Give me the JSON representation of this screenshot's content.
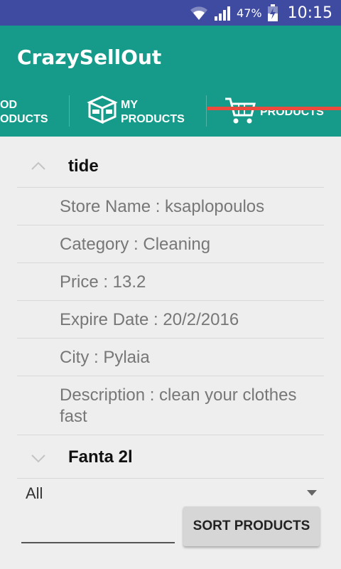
{
  "status_bar": {
    "battery_percent": "47%",
    "time": "10:15"
  },
  "app": {
    "title": "CrazySellOut"
  },
  "tabs": [
    {
      "label": "OD\nODUCTS"
    },
    {
      "label": "MY\nPRODUCTS"
    },
    {
      "label": "PRODUCTS"
    }
  ],
  "product_expanded": {
    "name": "tide",
    "fields": [
      "Store Name : ksaplopoulos",
      "Category : Cleaning",
      "Price : 13.2",
      "Expire Date : 20/2/2016",
      "City : Pylaia",
      "Description : clean your clothes fast"
    ]
  },
  "product_collapsed": {
    "name": "Fanta 2l"
  },
  "filter": {
    "selected": "All"
  },
  "search": {
    "value": ""
  },
  "sort_button": {
    "label": "SORT PRODUCTS"
  },
  "colors": {
    "status_bar": "#3f4ba0",
    "app_bar": "#169b8a",
    "tab_indicator": "#ec4a3c"
  }
}
